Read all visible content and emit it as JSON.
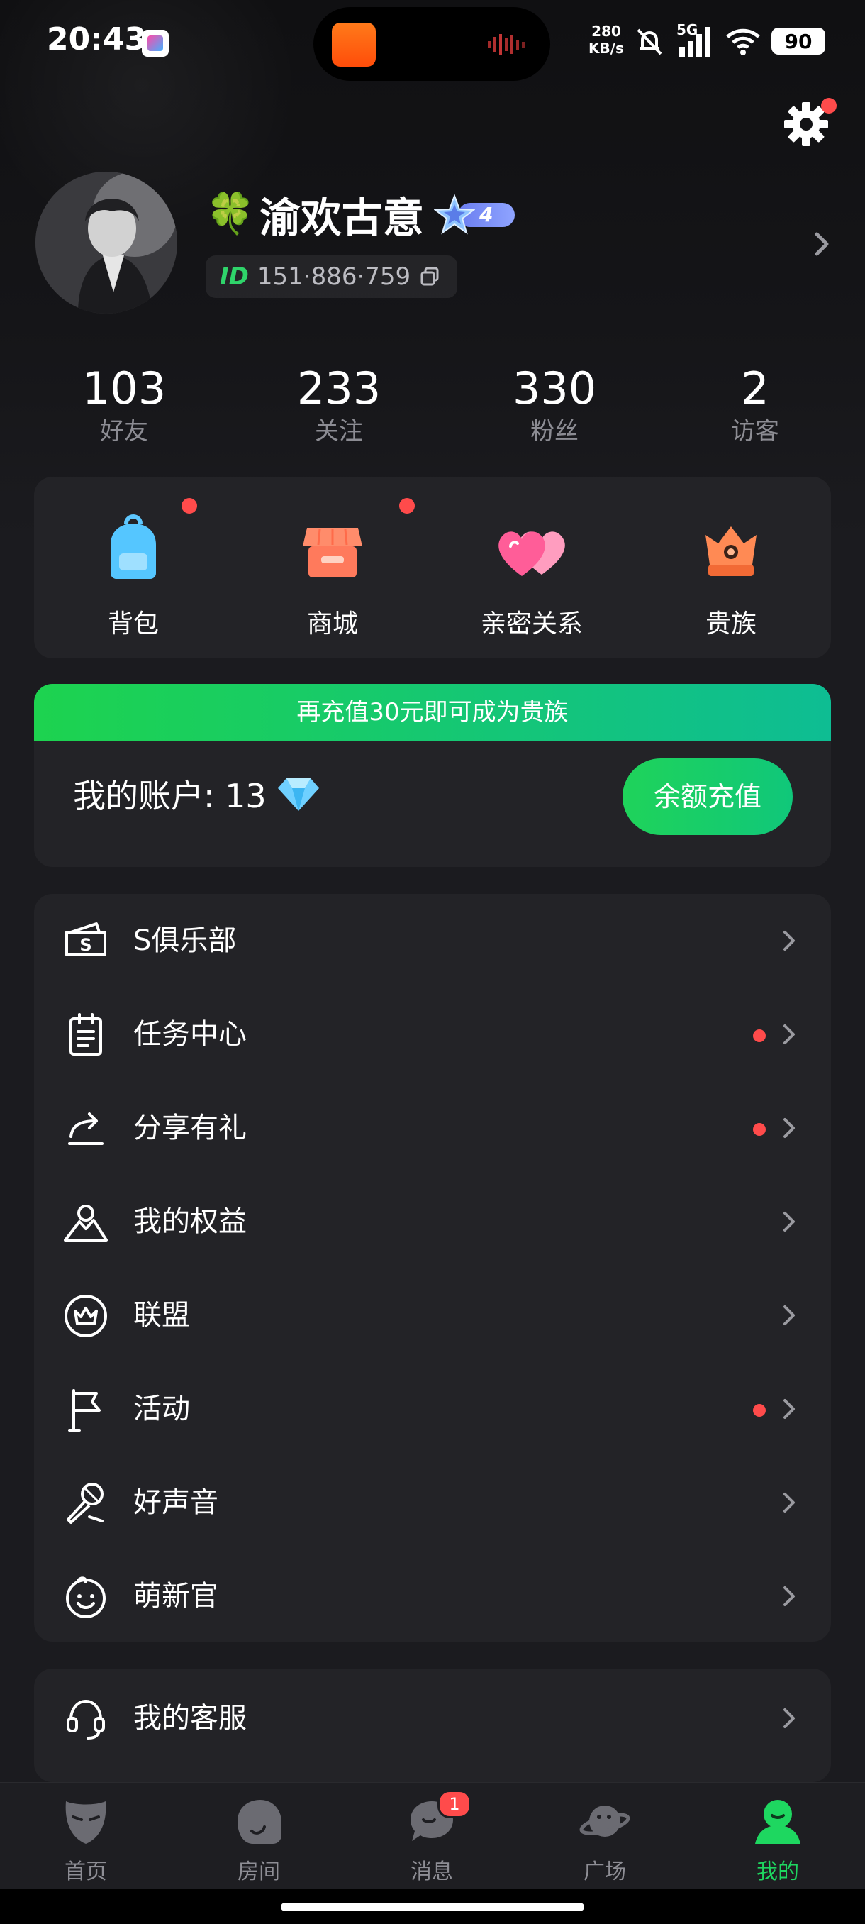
{
  "status_bar": {
    "time": "20:43",
    "net_speed_value": "280",
    "net_speed_unit": "KB/s",
    "network": "5G",
    "battery": "90"
  },
  "profile": {
    "nickname": "渝欢古意",
    "level": "4",
    "id_label": "ID",
    "id_value": "151·886·759"
  },
  "stats": [
    {
      "value": "103",
      "label": "好友"
    },
    {
      "value": "233",
      "label": "关注"
    },
    {
      "value": "330",
      "label": "粉丝"
    },
    {
      "value": "2",
      "label": "访客"
    }
  ],
  "quick_actions": [
    {
      "label": "背包",
      "icon": "backpack-icon",
      "has_dot": true
    },
    {
      "label": "商城",
      "icon": "shop-icon",
      "has_dot": true
    },
    {
      "label": "亲密关系",
      "icon": "hearts-icon",
      "has_dot": false
    },
    {
      "label": "贵族",
      "icon": "crown-icon",
      "has_dot": false
    }
  ],
  "account": {
    "banner": "再充值30元即可成为贵族",
    "label": "我的账户: 13",
    "recharge_button": "余额充值"
  },
  "menu": [
    {
      "label": "S俱乐部",
      "icon": "club-ticket-icon",
      "has_dot": false
    },
    {
      "label": "任务中心",
      "icon": "clipboard-icon",
      "has_dot": true
    },
    {
      "label": "分享有礼",
      "icon": "share-icon",
      "has_dot": true
    },
    {
      "label": "我的权益",
      "icon": "mountain-icon",
      "has_dot": false
    },
    {
      "label": "联盟",
      "icon": "alliance-crown-icon",
      "has_dot": false
    },
    {
      "label": "活动",
      "icon": "flag-icon",
      "has_dot": true
    },
    {
      "label": "好声音",
      "icon": "microphone-icon",
      "has_dot": false
    },
    {
      "label": "萌新官",
      "icon": "smiley-icon",
      "has_dot": false
    }
  ],
  "service": {
    "label": "我的客服",
    "icon": "headset-icon"
  },
  "bottom_nav": [
    {
      "label": "首页",
      "icon": "mask-icon",
      "active": false
    },
    {
      "label": "房间",
      "icon": "room-icon",
      "active": false
    },
    {
      "label": "消息",
      "icon": "chat-icon",
      "active": false,
      "badge": "1"
    },
    {
      "label": "广场",
      "icon": "planet-icon",
      "active": false
    },
    {
      "label": "我的",
      "icon": "me-icon",
      "active": true
    }
  ],
  "colors": {
    "accent_green": "#1ed760",
    "badge_red": "#ff4b4b",
    "card_bg": "#232327",
    "page_bg": "#1b1b1f"
  }
}
